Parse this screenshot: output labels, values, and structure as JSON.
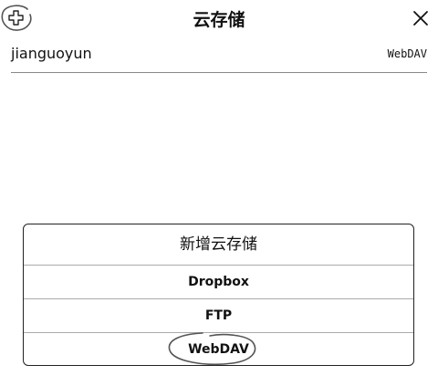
{
  "header": {
    "title": "云存储",
    "add_icon": "plus-icon",
    "close_icon": "close-icon"
  },
  "accounts": [
    {
      "name": "jianguoyun",
      "type": "WebDAV"
    }
  ],
  "dialog": {
    "title": "新增云存储",
    "options": [
      {
        "label": "Dropbox"
      },
      {
        "label": "FTP"
      },
      {
        "label": "WebDAV"
      }
    ]
  },
  "colors": {
    "text": "#111111",
    "divider": "#888888",
    "dialog_border": "#222222",
    "annotation": "#555555"
  }
}
